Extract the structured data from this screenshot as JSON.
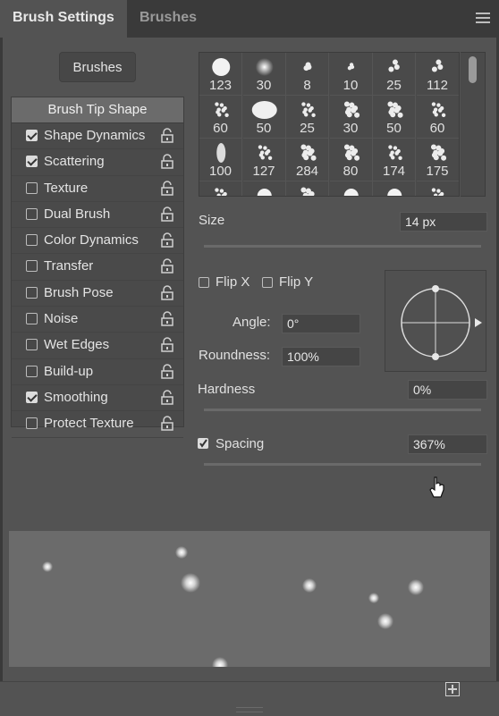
{
  "tabs": [
    {
      "label": "Brush Settings",
      "active": true
    },
    {
      "label": "Brushes",
      "active": false
    }
  ],
  "brushes_button": "Brushes",
  "options": {
    "header": "Brush Tip Shape",
    "items": [
      {
        "label": "Shape Dynamics",
        "checked": true
      },
      {
        "label": "Scattering",
        "checked": true
      },
      {
        "label": "Texture",
        "checked": false
      },
      {
        "label": "Dual Brush",
        "checked": false
      },
      {
        "label": "Color Dynamics",
        "checked": false
      },
      {
        "label": "Transfer",
        "checked": false
      },
      {
        "label": "Brush Pose",
        "checked": false
      },
      {
        "label": "Noise",
        "checked": false
      },
      {
        "label": "Wet Edges",
        "checked": false
      },
      {
        "label": "Build-up",
        "checked": false
      },
      {
        "label": "Smoothing",
        "checked": true
      },
      {
        "label": "Protect Texture",
        "checked": false
      }
    ]
  },
  "presets": {
    "rows": [
      [
        "123",
        "30",
        "8",
        "10",
        "25",
        "112"
      ],
      [
        "60",
        "50",
        "25",
        "30",
        "50",
        "60"
      ],
      [
        "100",
        "127",
        "284",
        "80",
        "174",
        "175"
      ],
      [
        "",
        "",
        "",
        "",
        "",
        ""
      ]
    ]
  },
  "size": {
    "label": "Size",
    "value": "14 px",
    "slider_fraction": 0.06
  },
  "flip_x": {
    "label": "Flip X",
    "checked": false
  },
  "flip_y": {
    "label": "Flip Y",
    "checked": false
  },
  "angle": {
    "label": "Angle:",
    "value": "0°"
  },
  "roundness": {
    "label": "Roundness:",
    "value": "100%"
  },
  "hardness": {
    "label": "Hardness",
    "value": "0%",
    "slider_fraction": 0.0
  },
  "spacing": {
    "label": "Spacing",
    "value": "367%",
    "checked": true,
    "slider_fraction": 0.84
  },
  "colors": {
    "panel": "#535353",
    "tabbar": "#3a3a3a",
    "preview": "#6b6b6b"
  }
}
